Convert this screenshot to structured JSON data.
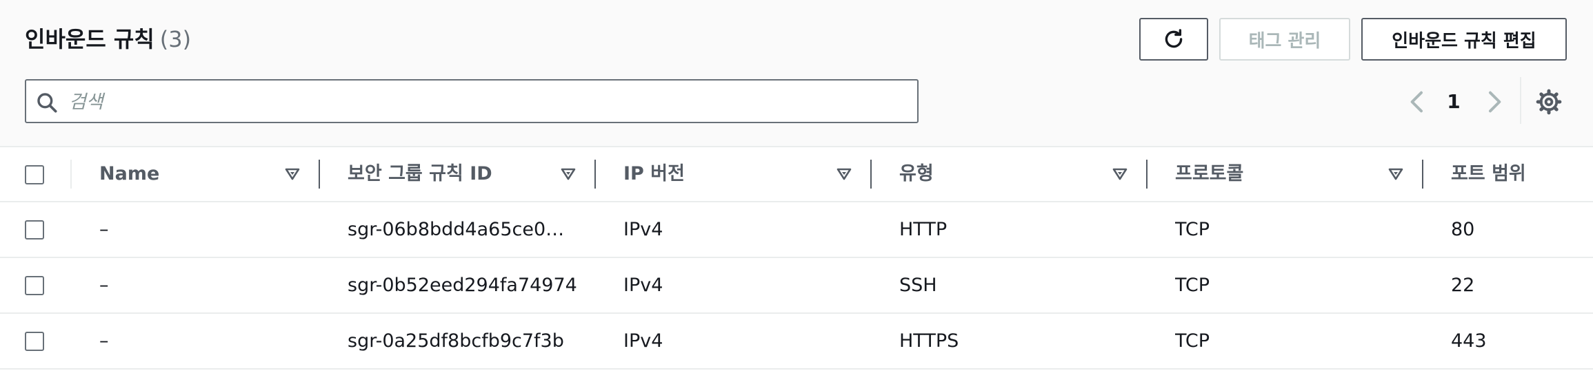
{
  "header": {
    "title": "인바운드 규칙",
    "count": "(3)"
  },
  "buttons": {
    "refresh_icon": "refresh-icon",
    "manage_tags": "태그 관리",
    "edit_inbound_rules": "인바운드 규칙 편집"
  },
  "search": {
    "placeholder": "검색",
    "value": ""
  },
  "pagination": {
    "current_page": "1"
  },
  "table": {
    "columns": [
      "Name",
      "보안 그룹 규칙 ID",
      "IP 버전",
      "유형",
      "프로토콜",
      "포트 범위"
    ],
    "rows": [
      {
        "name": "–",
        "rule_id": "sgr-06b8bdd4a65ce0e…",
        "ip_version": "IPv4",
        "type": "HTTP",
        "protocol": "TCP",
        "port_range": "80"
      },
      {
        "name": "–",
        "rule_id": "sgr-0b52eed294fa74974",
        "ip_version": "IPv4",
        "type": "SSH",
        "protocol": "TCP",
        "port_range": "22"
      },
      {
        "name": "–",
        "rule_id": "sgr-0a25df8bcfb9c7f3b",
        "ip_version": "IPv4",
        "type": "HTTPS",
        "protocol": "TCP",
        "port_range": "443"
      }
    ]
  },
  "colors": {
    "primary_text": "#16191f",
    "secondary_text": "#545b64",
    "disabled_text": "#aab7b8",
    "border": "#eaeded",
    "header_background": "#fafafa"
  }
}
